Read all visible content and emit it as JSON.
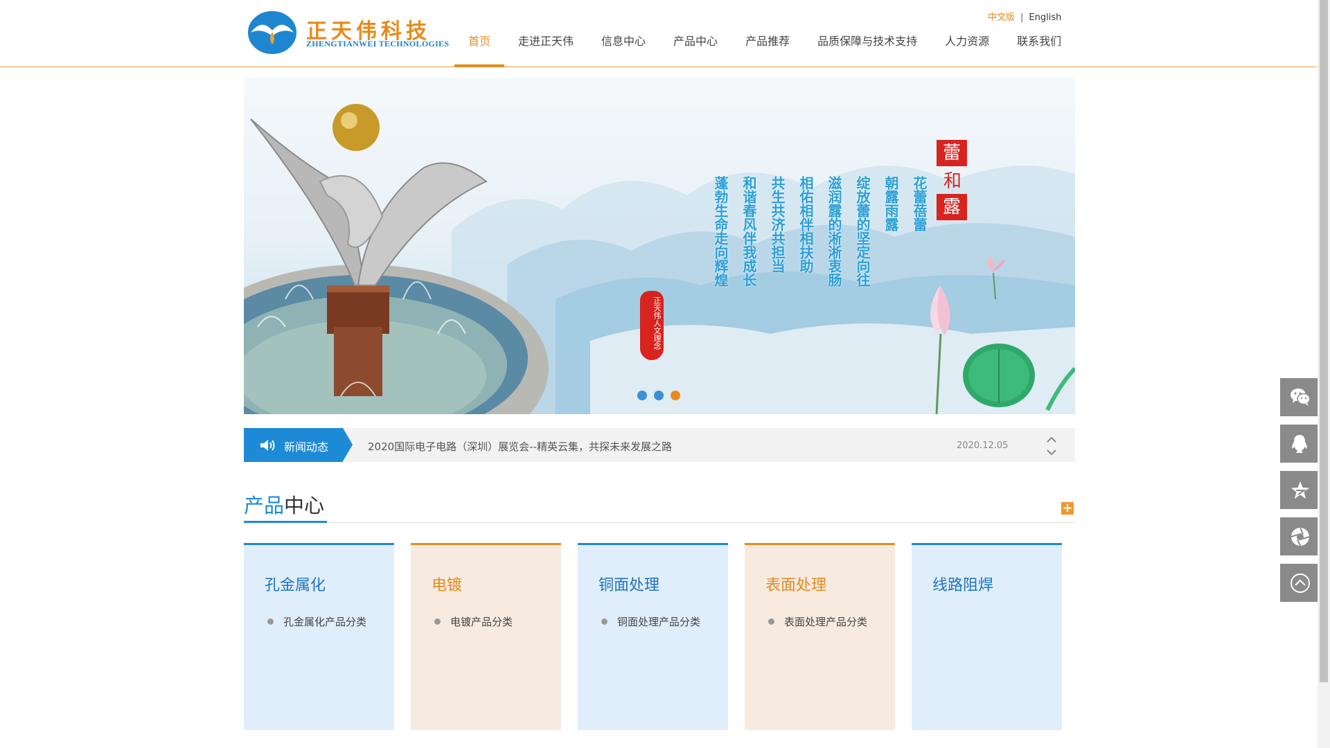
{
  "header": {
    "logo": {
      "cn": "正天伟科技",
      "en": "ZHENGTIANWEI TECHNOLOGIES"
    },
    "lang": {
      "cn": "中文版",
      "separator": "|",
      "en": "English"
    },
    "nav": [
      {
        "label": "首页",
        "active": true
      },
      {
        "label": "走进正天伟"
      },
      {
        "label": "信息中心"
      },
      {
        "label": "产品中心"
      },
      {
        "label": "产品推荐"
      },
      {
        "label": "品质保障与技术支持"
      },
      {
        "label": "人力资源"
      },
      {
        "label": "联系我们"
      }
    ]
  },
  "banner": {
    "poem_title": [
      "蕾",
      "和",
      "露"
    ],
    "poem_columns": [
      "花蕾蓓蕾",
      "朝露雨露",
      "绽放蕾的坚定向往",
      "滋润露的淅淅衷肠",
      "相佑相伴相扶助",
      "共生共济共担当",
      "和谐春风伴我成长",
      "蓬勃生命走向辉煌"
    ],
    "seal_text": "正天伟人文理念",
    "slides": 3,
    "active_slide": 2
  },
  "news": {
    "label": "新闻动态",
    "headline": "2020国际电子电路（深圳）展览会--精英云集，共探未来发展之路",
    "date": "2020.12.05"
  },
  "products": {
    "title_highlight": "产品",
    "title_rest": "中心",
    "more": "+",
    "cards": [
      {
        "title": "孔金属化",
        "sub": "孔金属化产品分类",
        "theme": "blue"
      },
      {
        "title": "电镀",
        "sub": "电镀产品分类",
        "theme": "orange"
      },
      {
        "title": "铜面处理",
        "sub": "铜面处理产品分类",
        "theme": "blue"
      },
      {
        "title": "表面处理",
        "sub": "表面处理产品分类",
        "theme": "orange"
      },
      {
        "title": "线路阻焊",
        "sub": "",
        "theme": "blue"
      }
    ]
  },
  "side_tools": [
    "wechat-icon",
    "qq-icon",
    "favorite-icon",
    "aperture-icon",
    "back-to-top-icon"
  ],
  "colors": {
    "orange": "#e88a1a",
    "blue": "#1d8ad6",
    "card_blue_bg": "#e0eefb",
    "card_orange_bg": "#f7ebe1",
    "side_gray": "#8a8a8a"
  }
}
